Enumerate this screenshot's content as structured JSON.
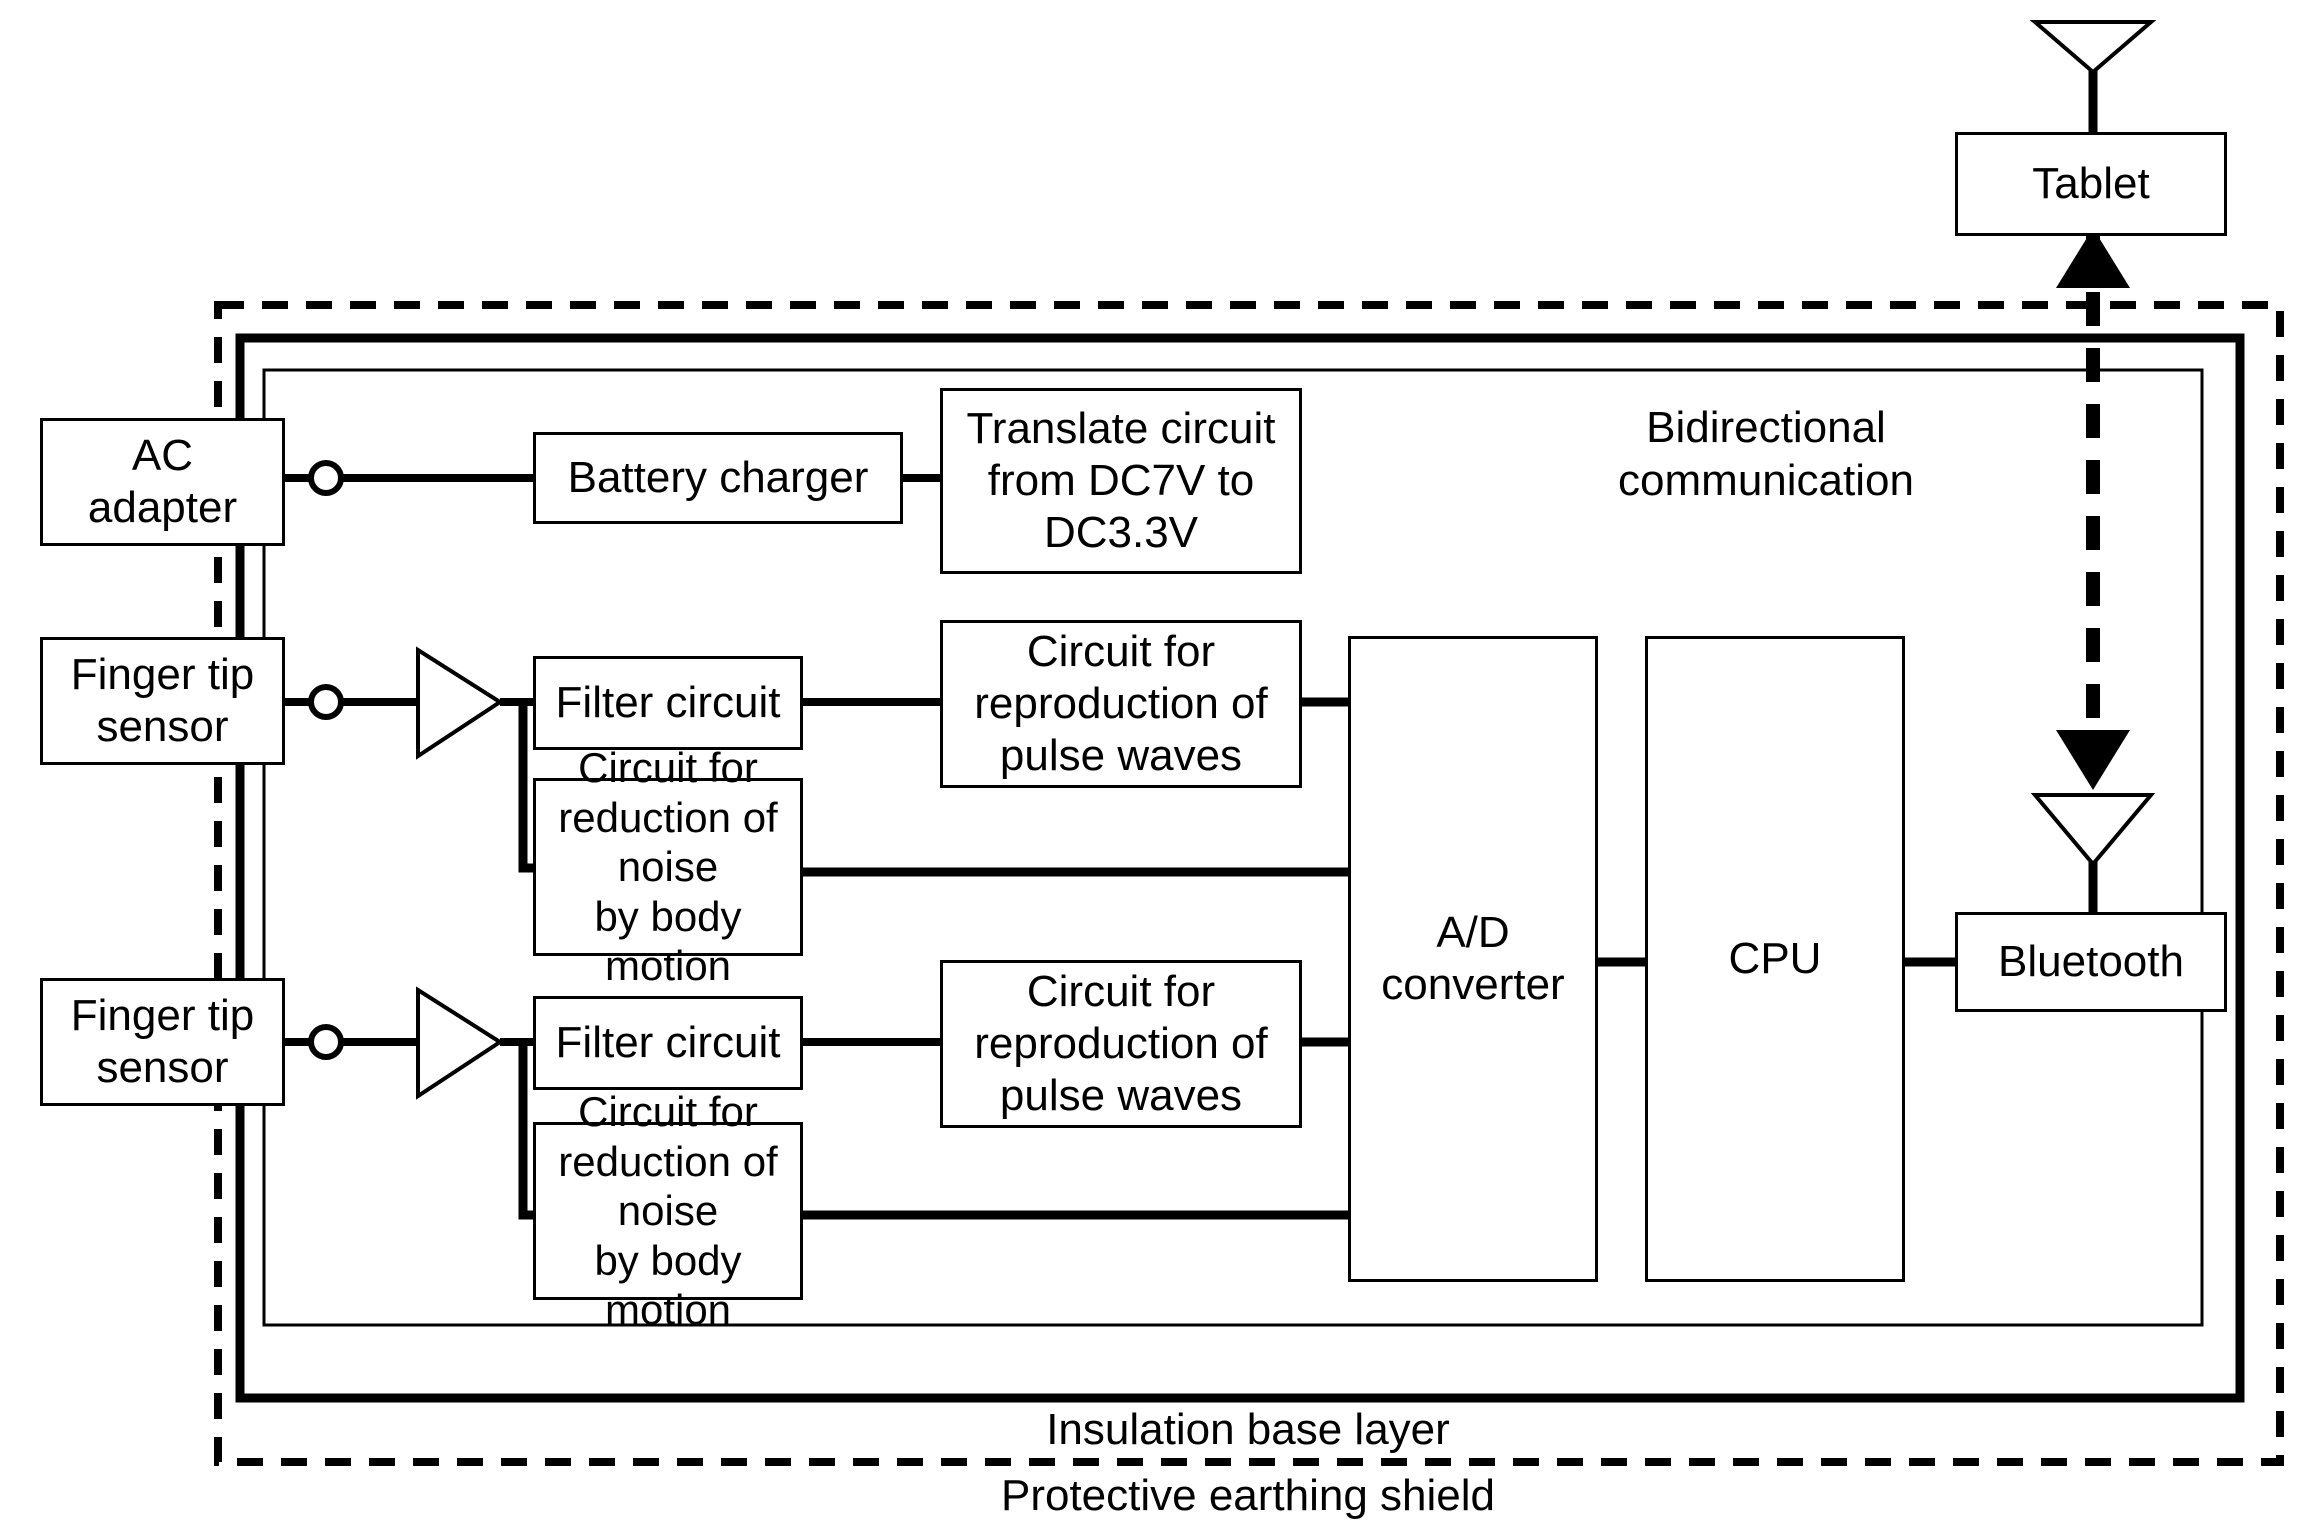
{
  "diagram": {
    "title": "Wearable pulse-wave measurement device block diagram",
    "colors": {
      "line": "#000000",
      "background": "#ffffff"
    },
    "boundaries": {
      "outer_dashed_label": "Protective earthing shield",
      "middle_thick_label": "Insulation base layer",
      "inner_thin_label": ""
    },
    "external_blocks": [
      {
        "id": "ac-adapter",
        "label": "AC\nadapter"
      },
      {
        "id": "finger-tip-sensor-1",
        "label": "Finger tip\nsensor"
      },
      {
        "id": "finger-tip-sensor-2",
        "label": "Finger tip\nsensor"
      },
      {
        "id": "tablet",
        "label": "Tablet"
      }
    ],
    "internal_blocks": [
      {
        "id": "battery-charger",
        "label": "Battery charger"
      },
      {
        "id": "translate-circuit",
        "label": "Translate circuit\nfrom DC7V to\nDC3.3V"
      },
      {
        "id": "filter-circuit-1",
        "label": "Filter circuit"
      },
      {
        "id": "reproduction-circuit-1",
        "label": "Circuit for\nreproduction of\npulse waves"
      },
      {
        "id": "noise-reduction-circuit-1",
        "label": "Circuit for\nreduction of noise\nby body motion"
      },
      {
        "id": "filter-circuit-2",
        "label": "Filter circuit"
      },
      {
        "id": "reproduction-circuit-2",
        "label": "Circuit for\nreproduction of\npulse waves"
      },
      {
        "id": "noise-reduction-circuit-2",
        "label": "Circuit for\nreduction of noise\nby body motion"
      },
      {
        "id": "ad-converter",
        "label": "A/D\nconverter"
      },
      {
        "id": "cpu",
        "label": "CPU"
      },
      {
        "id": "bluetooth",
        "label": "Bluetooth"
      }
    ],
    "annotations": [
      {
        "id": "bidirectional-communication",
        "label": "Bidirectional\ncommunication"
      },
      {
        "id": "insulation-base-layer",
        "label": "Insulation base layer"
      },
      {
        "id": "protective-earthing-shield",
        "label": "Protective earthing shield"
      }
    ],
    "symbols": [
      {
        "id": "antenna-tablet",
        "kind": "antenna-triangle"
      },
      {
        "id": "antenna-bluetooth",
        "kind": "antenna-triangle"
      },
      {
        "id": "amplifier-1",
        "kind": "amplifier-triangle"
      },
      {
        "id": "amplifier-2",
        "kind": "amplifier-triangle"
      },
      {
        "id": "terminal-ac",
        "kind": "terminal-circle"
      },
      {
        "id": "terminal-sensor-1",
        "kind": "terminal-circle"
      },
      {
        "id": "terminal-sensor-2",
        "kind": "terminal-circle"
      },
      {
        "id": "wireless-link",
        "kind": "dashed-double-arrow"
      }
    ]
  }
}
